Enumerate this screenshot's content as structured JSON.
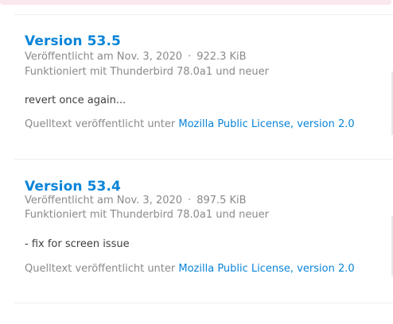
{
  "versions": [
    {
      "title": "Version 53.5",
      "published": "Veröffentlicht am Nov. 3, 2020",
      "separator": "·",
      "size": "922.3 KiB",
      "compatibility": "Funktioniert mit Thunderbird 78.0a1 und neuer",
      "notes": "revert once again...",
      "license_prefix": "Quelltext veröffentlicht unter",
      "license_link": "Mozilla Public License, version 2.0"
    },
    {
      "title": "Version 53.4",
      "published": "Veröffentlicht am Nov. 3, 2020",
      "separator": "·",
      "size": "897.5 KiB",
      "compatibility": "Funktioniert mit Thunderbird 78.0a1 und neuer",
      "notes": "- fix for screen issue",
      "license_prefix": "Quelltext veröffentlicht unter",
      "license_link": "Mozilla Public License, version 2.0"
    }
  ],
  "colors": {
    "accent": "#0a84d8",
    "meta_text": "#8a8a8a",
    "body_text": "#3d3d3d",
    "banner": "#fbe7ef"
  }
}
